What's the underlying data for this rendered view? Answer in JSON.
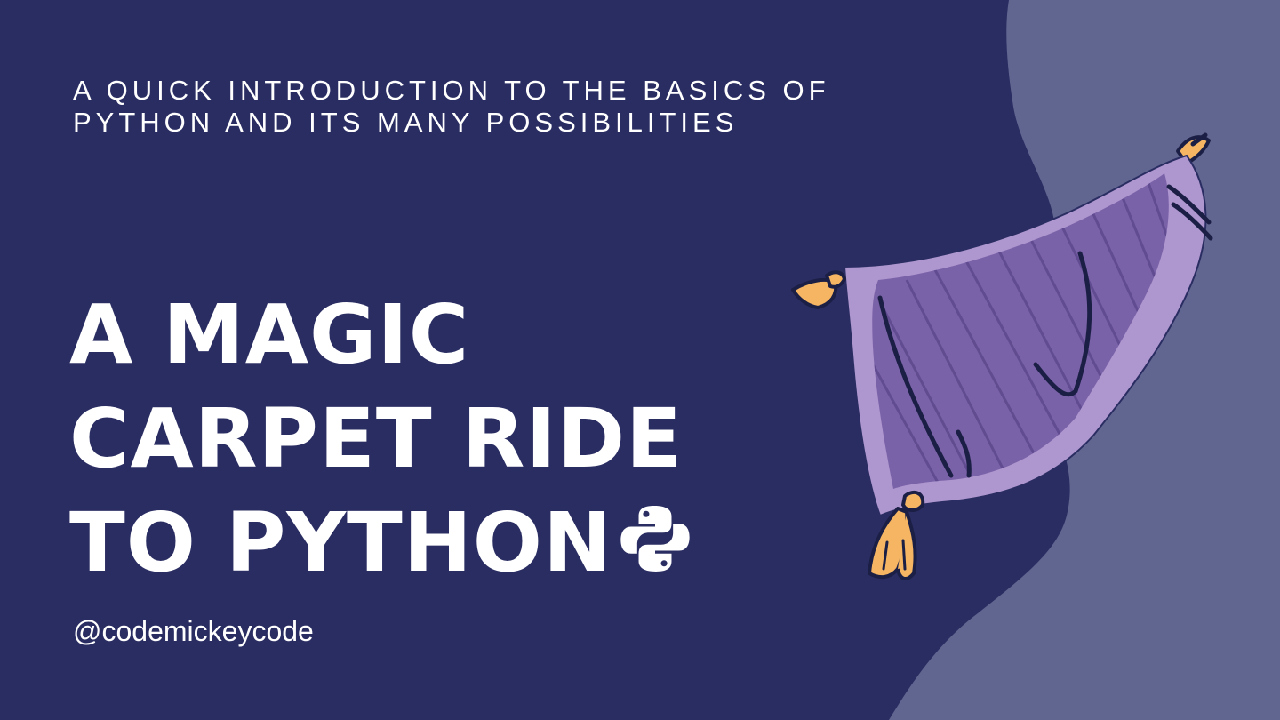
{
  "subtitle": {
    "line1": "A QUICK INTRODUCTION TO THE BASICS OF",
    "line2": "PYTHON AND ITS MANY POSSIBILITIES"
  },
  "title": {
    "line1": "A MAGIC",
    "line2": "CARPET RIDE",
    "line3": "TO PYTHON"
  },
  "handle": "@codemickeycode",
  "icons": {
    "title_icon": "python-logo-icon",
    "illustration": "magic-carpet-illustration"
  },
  "colors": {
    "background": "#2a2d62",
    "blob": "#616690",
    "carpet_border": "#ae96cf",
    "carpet_center": "#7a62a8",
    "tassel": "#f5b562",
    "ink": "#1c1f45",
    "text": "#ffffff"
  }
}
